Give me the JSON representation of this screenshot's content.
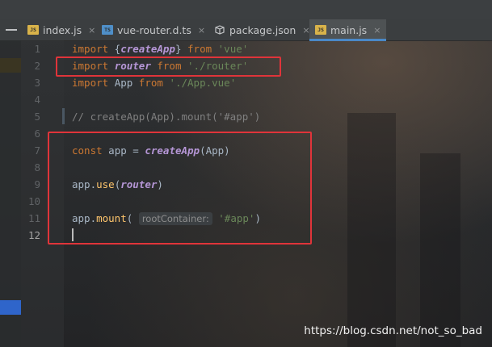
{
  "tabs": [
    {
      "label": "index.js",
      "icon": "js-file-icon",
      "icon_text": "JS",
      "active": false
    },
    {
      "label": "vue-router.d.ts",
      "icon": "ts-file-icon",
      "icon_text": "TS",
      "active": false
    },
    {
      "label": "package.json",
      "icon": "json-file-icon",
      "icon_text": "",
      "active": false
    },
    {
      "label": "main.js",
      "icon": "js-file-icon",
      "icon_text": "JS",
      "active": true
    }
  ],
  "close_glyph": "×",
  "line_numbers": [
    "1",
    "2",
    "3",
    "4",
    "5",
    "6",
    "7",
    "8",
    "9",
    "10",
    "11",
    "12"
  ],
  "current_line": "12",
  "code": {
    "l1": {
      "kw": "import",
      "p1": " {",
      "fn": "createApp",
      "p2": "} ",
      "kw2": "from",
      "sp": " ",
      "str": "'vue'"
    },
    "l2": {
      "kw": "import",
      "fn": "router",
      "kw2": "from",
      "str": "'./router'"
    },
    "l3": {
      "kw": "import",
      "id": "App",
      "kw2": "from",
      "str": "'./App.vue'"
    },
    "l5": {
      "comment": "// createApp(App).mount('#app')"
    },
    "l7": {
      "kw": "const",
      "id": "app",
      "eq": "=",
      "fn": "createApp",
      "arg": "(App)"
    },
    "l9": {
      "obj": "app.",
      "method": "use",
      "open": "(",
      "fn": "router",
      "close": ")"
    },
    "l11": {
      "obj": "app.",
      "method": "mount",
      "open": "(",
      "hint": "rootContainer:",
      "str": "'#app'",
      "close": ")"
    }
  },
  "watermark": "https://blog.csdn.net/not_so_bad",
  "colors": {
    "keyword": "#cc7832",
    "function": "#b596d6",
    "string": "#6a8759",
    "comment": "#808080",
    "method": "#ffc66d",
    "highlight_box": "#e0343a",
    "active_tab_underline": "#4a88c7"
  }
}
